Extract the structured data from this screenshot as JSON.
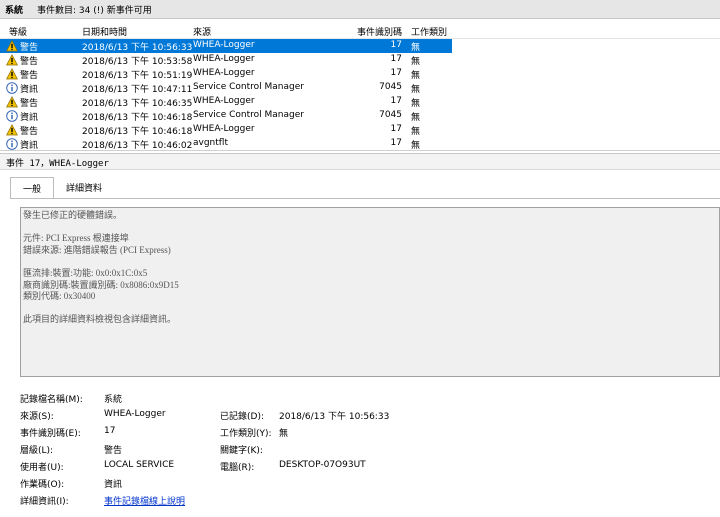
{
  "window": {
    "title": "系統",
    "subtitle": "事件數目: 34 (!) 新事件可用"
  },
  "columns": {
    "level": "等級",
    "date": "日期和時間",
    "source": "來源",
    "event_id": "事件識別碼",
    "category": "工作類別"
  },
  "events": [
    {
      "level": "警告",
      "icon": "warning-icon",
      "date": "2018/6/13 下午 10:56:33",
      "source": "WHEA-Logger",
      "id": "17",
      "category": "無",
      "selected": true
    },
    {
      "level": "警告",
      "icon": "warning-icon",
      "date": "2018/6/13 下午 10:53:58",
      "source": "WHEA-Logger",
      "id": "17",
      "category": "無"
    },
    {
      "level": "警告",
      "icon": "warning-icon",
      "date": "2018/6/13 下午 10:51:19",
      "source": "WHEA-Logger",
      "id": "17",
      "category": "無"
    },
    {
      "level": "資訊",
      "icon": "info-icon",
      "date": "2018/6/13 下午 10:47:11",
      "source": "Service Control Manager",
      "id": "7045",
      "category": "無"
    },
    {
      "level": "警告",
      "icon": "warning-icon",
      "date": "2018/6/13 下午 10:46:35",
      "source": "WHEA-Logger",
      "id": "17",
      "category": "無"
    },
    {
      "level": "資訊",
      "icon": "info-icon",
      "date": "2018/6/13 下午 10:46:18",
      "source": "Service Control Manager",
      "id": "7045",
      "category": "無"
    },
    {
      "level": "警告",
      "icon": "warning-icon",
      "date": "2018/6/13 下午 10:46:18",
      "source": "WHEA-Logger",
      "id": "17",
      "category": "無"
    },
    {
      "level": "資訊",
      "icon": "info-icon",
      "date": "2018/6/13 下午 10:46:02",
      "source": "avgntflt",
      "id": "17",
      "category": "無"
    }
  ],
  "detail": {
    "title": "事件 17，WHEA-Logger",
    "tabs": {
      "general": "一般",
      "details": "詳細資料"
    },
    "description": {
      "line1": "發生已修正的硬體錯誤。",
      "line2": "元件: PCI Express 根連接埠",
      "line3": "錯誤來源: 進階錯誤報告 (PCI Express)",
      "line4": "匯流排:裝置:功能: 0x0:0x1C:0x5",
      "line5": "廠商識別碼:裝置識別碼: 0x8086:0x9D15",
      "line6": "類別代碼: 0x30400",
      "line7": "此項目的詳細資料檢視包含詳細資訊。"
    },
    "props": {
      "log_name_label": "記錄檔名稱(M):",
      "log_name_value": "系統",
      "source_label": "來源(S):",
      "source_value": "WHEA-Logger",
      "logged_label": "已記錄(D):",
      "logged_value": "2018/6/13 下午 10:56:33",
      "event_id_label": "事件識別碼(E):",
      "event_id_value": "17",
      "task_label": "工作類別(Y):",
      "task_value": "無",
      "level_label": "層級(L):",
      "level_value": "警告",
      "keywords_label": "關鍵字(K):",
      "keywords_value": "",
      "user_label": "使用者(U):",
      "user_value": "LOCAL SERVICE",
      "computer_label": "電腦(R):",
      "computer_value": "DESKTOP-07O93UT",
      "opcode_label": "作業碼(O):",
      "opcode_value": "資訊",
      "more_info_label": "詳細資訊(I):",
      "more_info_link": "事件記錄檔線上說明"
    }
  }
}
